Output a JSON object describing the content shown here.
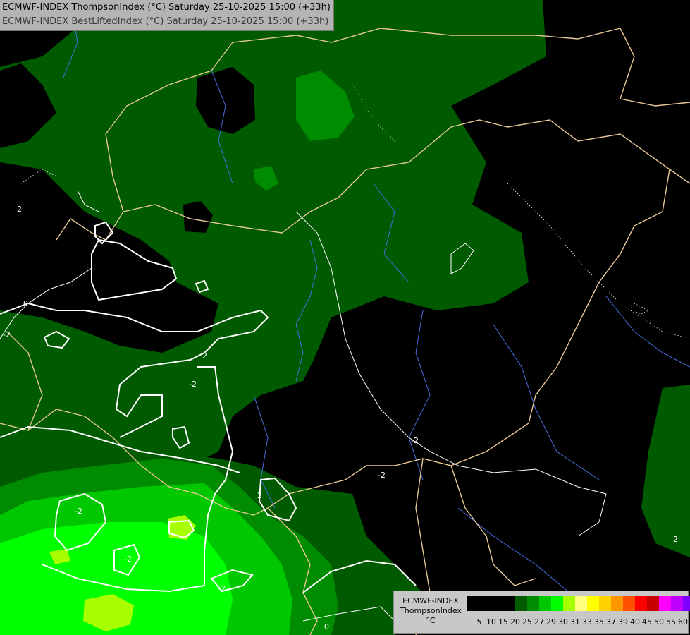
{
  "header": {
    "line1": "ECMWF-INDEX ThompsonIndex (°C) Saturday 25-10-2025 15:00 (+33h)",
    "line2": "ECMWF-INDEX BestLiftedIndex (°C) Saturday 25-10-2025 15:00 (+33h)"
  },
  "legend": {
    "label1": "ECMWF-INDEX",
    "label2": "ThompsonIndex",
    "unit": "°C",
    "ticks": [
      "5",
      "10",
      "15",
      "20",
      "25",
      "27",
      "29",
      "30",
      "31",
      "33",
      "35",
      "37",
      "39",
      "40",
      "45",
      "50",
      "55",
      "60"
    ],
    "colors": [
      "#000000",
      "#000000",
      "#000000",
      "#000000",
      "#005a00",
      "#008c00",
      "#00c800",
      "#00ff00",
      "#a8ff00",
      "#ffff80",
      "#ffff00",
      "#ffd200",
      "#ff9600",
      "#ff5000",
      "#ff0000",
      "#c80000",
      "#ff00ff",
      "#c000ff",
      "#8000ff",
      "#0000ff"
    ]
  },
  "contour_labels": [
    "2",
    "0",
    "-2",
    "2",
    "-2",
    "2",
    "-2",
    "-2",
    "-2",
    "-2",
    "-2",
    "0",
    "2"
  ],
  "colors": {
    "background": "#000000",
    "border": "#e8c896",
    "river": "#4a6ee0",
    "contour": "#ffffff"
  }
}
